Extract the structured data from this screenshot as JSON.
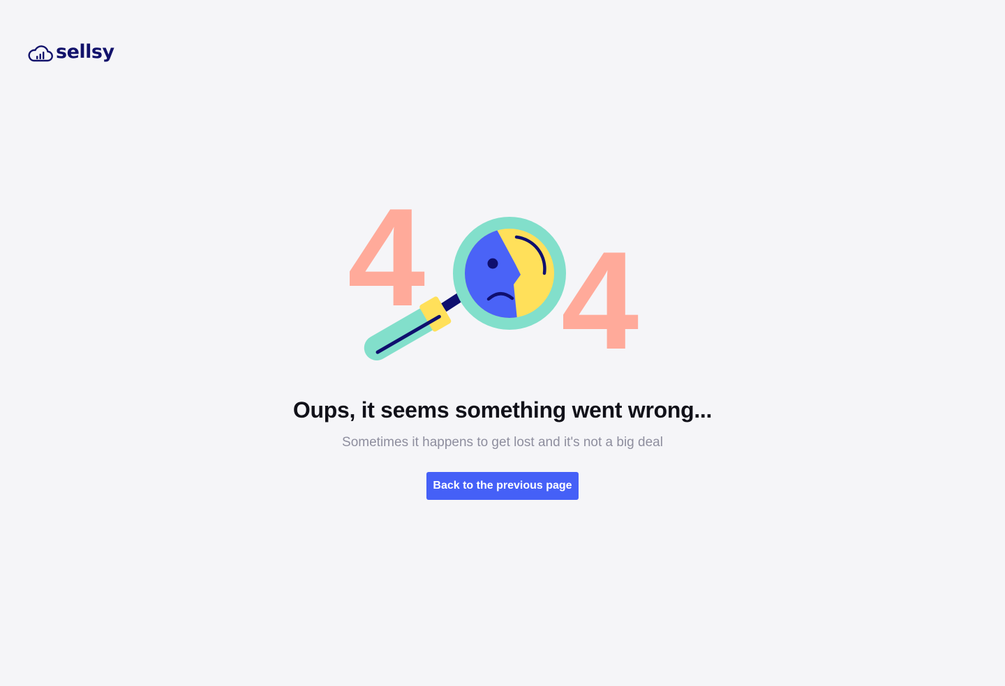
{
  "brand": {
    "name": "sellsy",
    "color": "#12126b",
    "logo_icon": "cloud-chart-icon"
  },
  "illustration": {
    "first_digit": "4",
    "last_digit": "4",
    "digit_color": "#ffaa9a",
    "icon": "magnifier-sad-face-icon",
    "lens_ring_color": "#82dfcb",
    "face_yellow": "#ffe05a",
    "face_blue": "#4a63f7",
    "handle_accent": "#ffe05a",
    "line_color": "#0f0f6e"
  },
  "error": {
    "title": "Oups, it seems something went wrong...",
    "message": "Sometimes it happens to get lost and it's not a big deal",
    "title_color": "#111119",
    "message_color": "#8e8e9e"
  },
  "actions": {
    "back_label": "Back to the previous page",
    "back_color": "#4560f7"
  },
  "page": {
    "background": "#f5f5f8"
  }
}
